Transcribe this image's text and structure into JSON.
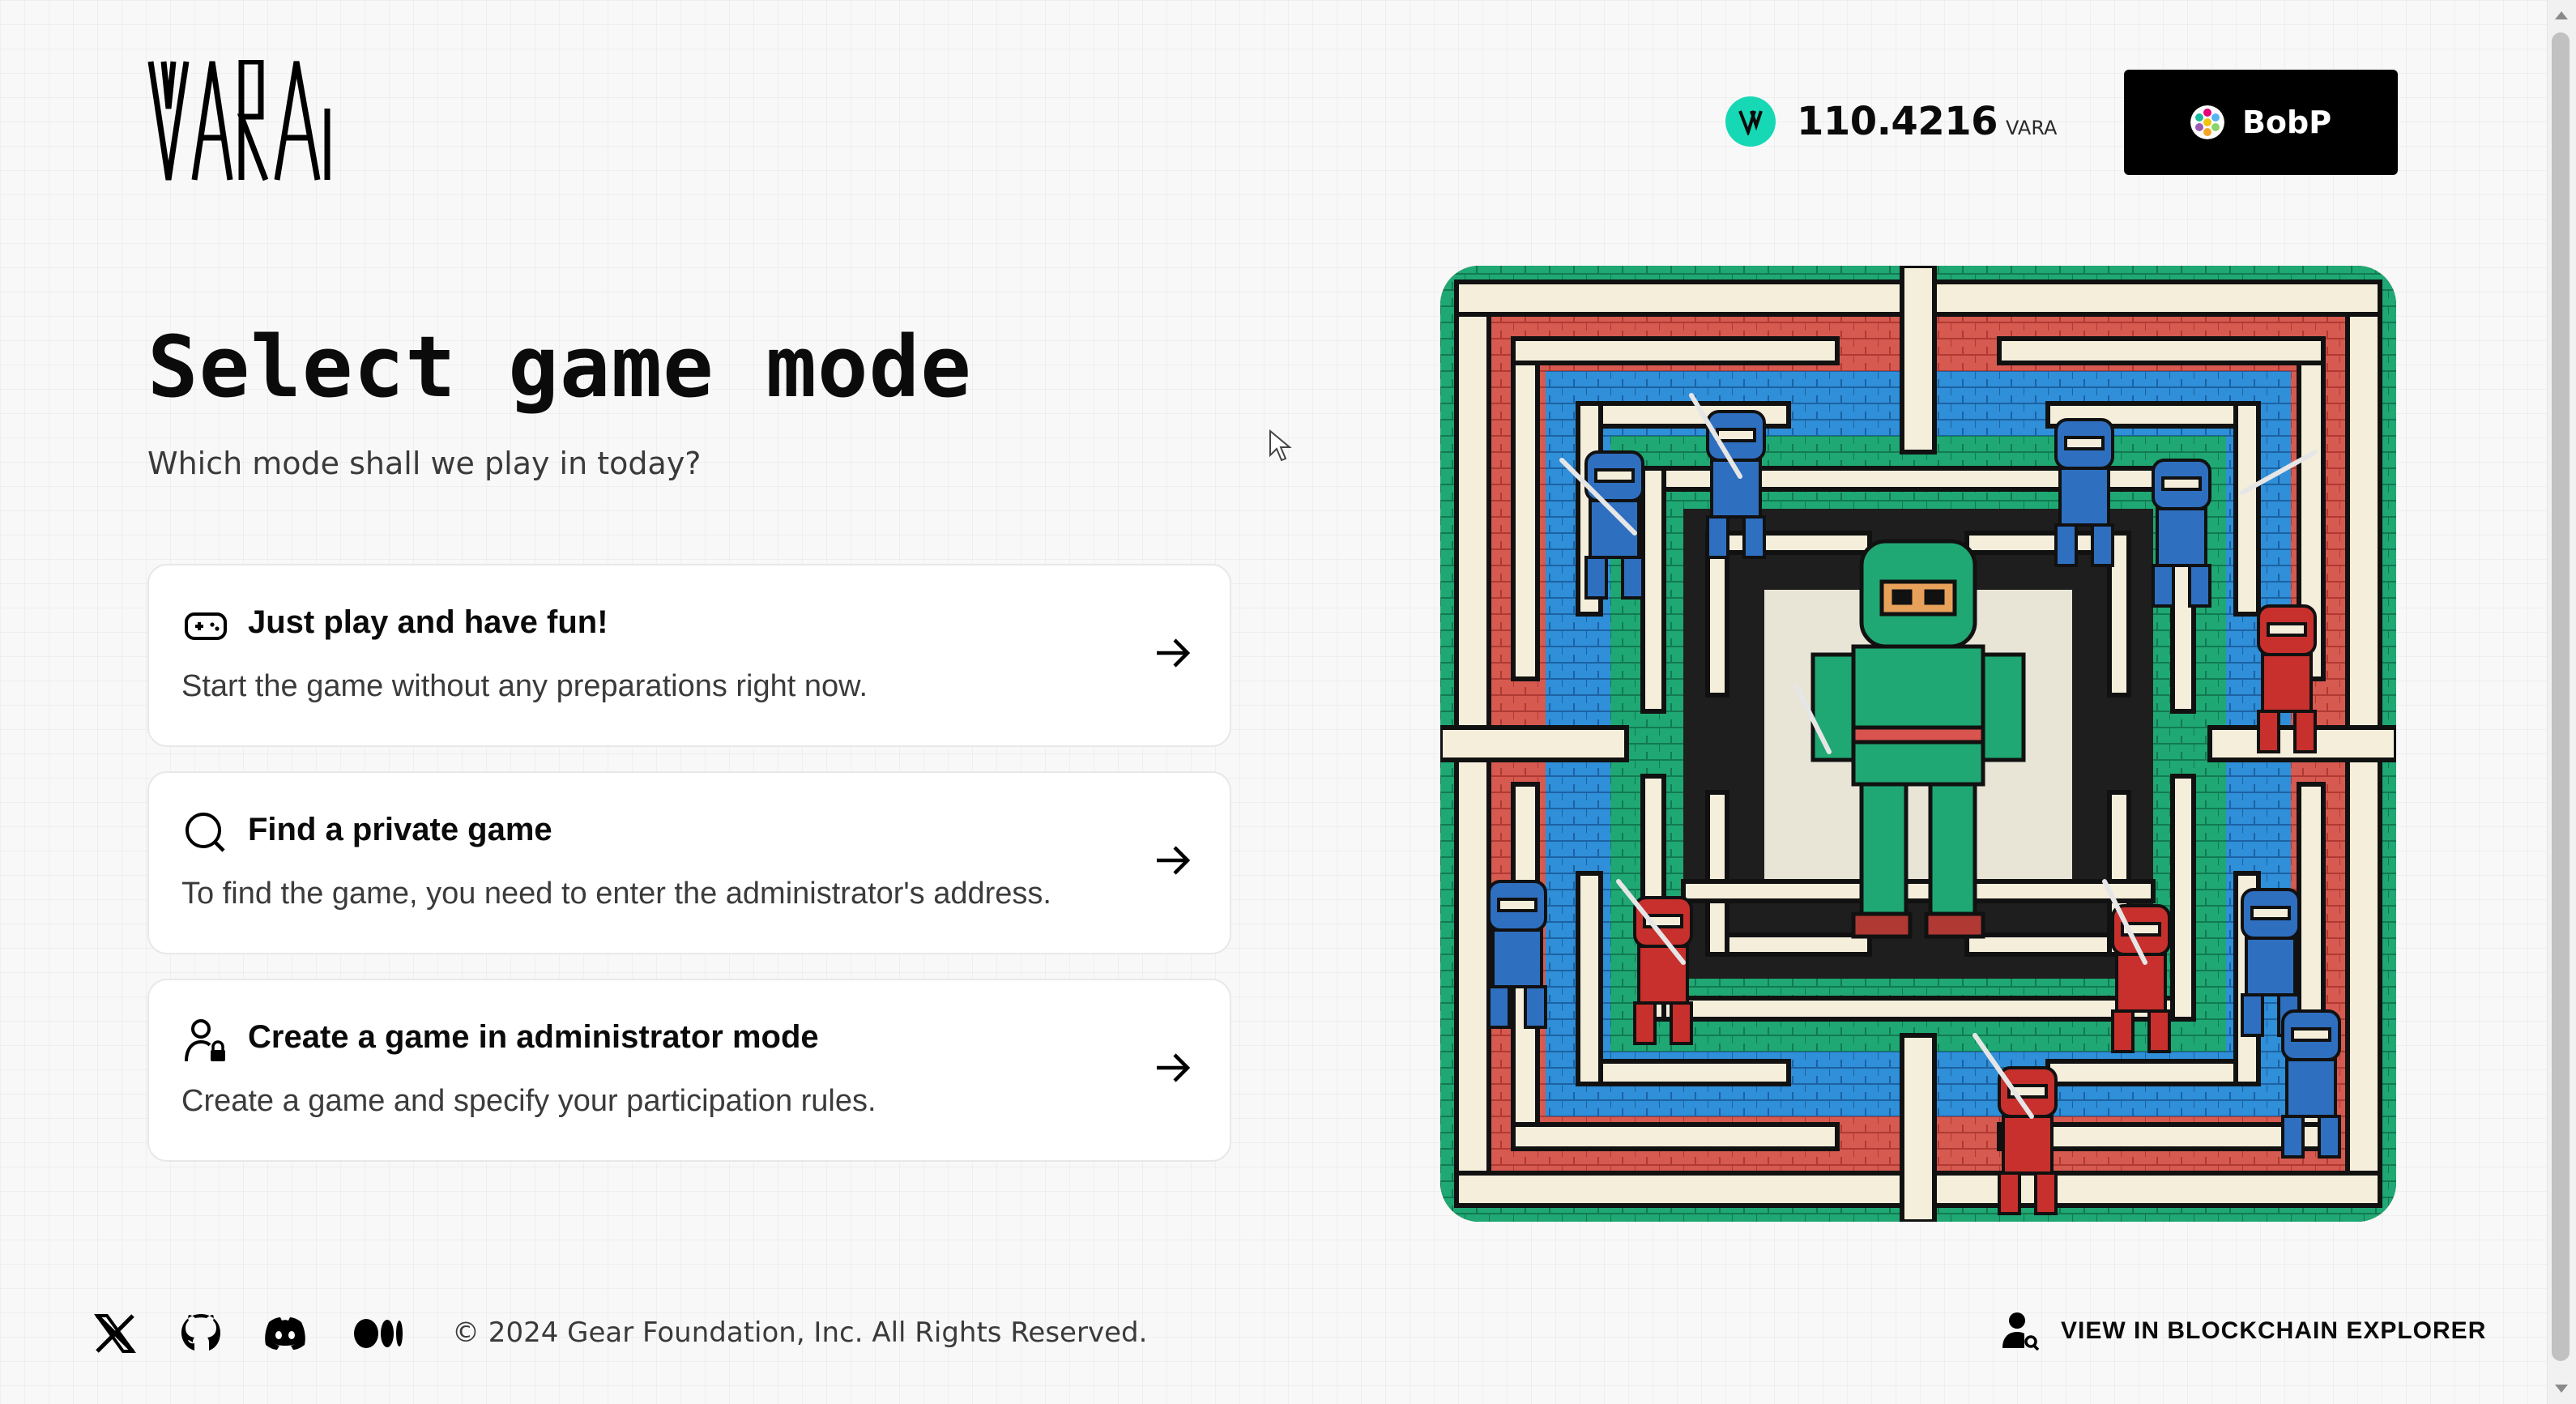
{
  "header": {
    "logo_text": "VARA",
    "balance": {
      "value": "110.4216",
      "unit": "VARA"
    },
    "wallet": {
      "name": "BobP"
    }
  },
  "main": {
    "title": "Select game mode",
    "subtitle": "Which mode shall we play in today?",
    "modes": [
      {
        "icon": "gamepad-icon",
        "title": "Just play and have fun!",
        "description": "Start the game without any preparations right now."
      },
      {
        "icon": "search-icon",
        "title": "Find a private game",
        "description": "To find the game, you need to enter the administrator's address."
      },
      {
        "icon": "user-lock-icon",
        "title": "Create a game in administrator mode",
        "description": "Create a game and specify your participation rules."
      }
    ]
  },
  "footer": {
    "socials": [
      "x-icon",
      "github-icon",
      "discord-icon",
      "medium-icon"
    ],
    "copyright": "© 2024 Gear Foundation, Inc. All Rights Reserved.",
    "explorer_label": "VIEW IN BLOCKCHAIN EXPLORER"
  },
  "colors": {
    "accent": "#16d8b5",
    "button_bg": "#000000",
    "maze_green": "#1fa873",
    "maze_blue": "#2f8fd8",
    "maze_red": "#d9534f",
    "maze_cream": "#f4eedb"
  }
}
